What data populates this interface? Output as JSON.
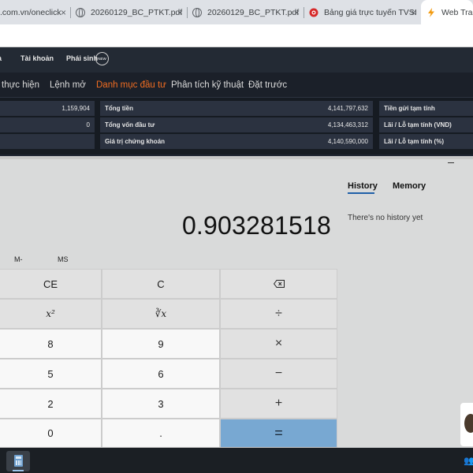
{
  "browser": {
    "tabs": [
      {
        "title": ".com.vn/oneclick",
        "icon": "none"
      },
      {
        "title": "20260129_BC_PTKT.pdf",
        "icon": "globe-icon"
      },
      {
        "title": "20260129_BC_PTKT.pdf",
        "icon": "globe-icon"
      },
      {
        "title": "Bảng giá trực tuyến TVSI",
        "icon": "tvsi-logo-icon"
      },
      {
        "title": "Web Trading",
        "icon": "lightning-icon"
      }
    ],
    "close_symbol": "×"
  },
  "trading": {
    "nav": {
      "account": "Tài khoản",
      "derivatives": "Phái sinh",
      "new_badge": "NEW"
    },
    "tabs": {
      "executed": "thực hiện",
      "open_orders": "Lệnh mở",
      "portfolio": "Danh mục đầu tư",
      "technical": "Phân tích kỹ thuật",
      "preorder": "Đặt trước"
    },
    "summary": {
      "left_value_1": "1,159,904",
      "left_value_2": "0",
      "total_money_label": "Tổng tiền",
      "total_money_value": "4,141,797,632",
      "total_invest_label": "Tổng vốn đầu tư",
      "total_invest_value": "4,134,463,312",
      "stock_value_label": "Giá trị chứng khoán",
      "stock_value_value": "4,140,590,000",
      "deposit_label": "Tiền gửi tạm tính",
      "pnl_vnd_label": "Lãi / Lỗ tạm tính (VND)",
      "pnl_pct_label": "Lãi / Lỗ tạm tính (%)"
    },
    "colors": {
      "active_tab": "#f26d21"
    }
  },
  "calculator": {
    "display": "0.903281518",
    "memory": {
      "m_minus": "M-",
      "ms": "MS"
    },
    "keys": {
      "ce": "CE",
      "c": "C",
      "backspace": "⌫",
      "square": "x²",
      "cube_root": "∛x",
      "divide": "÷",
      "k8": "8",
      "k9": "9",
      "multiply": "×",
      "k5": "5",
      "k6": "6",
      "minus": "−",
      "k2": "2",
      "k3": "3",
      "plus": "+",
      "k0": "0",
      "decimal": ".",
      "equals": "="
    },
    "side": {
      "history_tab": "History",
      "memory_tab": "Memory",
      "empty_message": "There's no history yet"
    },
    "colors": {
      "equals_key": "#78a8d2"
    }
  },
  "taskbar": {
    "app_icon": "calculator-icon"
  }
}
